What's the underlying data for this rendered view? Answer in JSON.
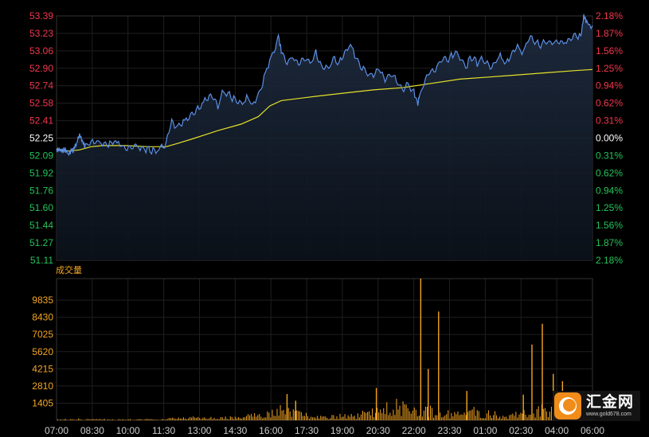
{
  "chart_data": [
    {
      "type": "line",
      "title": "",
      "price_ticks": [
        "53.39",
        "53.23",
        "53.06",
        "52.90",
        "52.74",
        "52.58",
        "52.41",
        "52.25",
        "52.09",
        "51.92",
        "51.76",
        "51.60",
        "51.44",
        "51.27",
        "51.11"
      ],
      "pct_ticks": [
        "2.18%",
        "1.87%",
        "1.56%",
        "1.25%",
        "0.94%",
        "0.62%",
        "0.31%",
        "0.00%",
        "0.31%",
        "0.62%",
        "0.94%",
        "1.25%",
        "1.56%",
        "1.87%",
        "2.18%"
      ],
      "ylim": [
        51.11,
        53.39
      ],
      "reference_price": 52.25,
      "x_ticks": [
        "07:00",
        "08:30",
        "10:00",
        "11:30",
        "13:00",
        "14:30",
        "16:00",
        "17:30",
        "19:00",
        "20:30",
        "22:00",
        "23:30",
        "01:00",
        "02:30",
        "04:00",
        "06:00"
      ],
      "series": [
        {
          "color": "#5b8fe6",
          "points": [
            [
              0,
              52.15
            ],
            [
              0.5,
              52.14
            ],
            [
              1,
              52.12
            ],
            [
              1.5,
              52.14
            ],
            [
              2,
              52.1
            ],
            [
              2.5,
              52.13
            ],
            [
              3,
              52.15
            ],
            [
              3.5,
              52.2
            ],
            [
              4,
              52.28
            ],
            [
              4.5,
              52.22
            ],
            [
              5,
              52.18
            ],
            [
              6,
              52.2
            ],
            [
              7,
              52.22
            ],
            [
              8,
              52.2
            ],
            [
              9,
              52.18
            ],
            [
              10,
              52.22
            ],
            [
              11,
              52.18
            ],
            [
              12,
              52.17
            ],
            [
              13,
              52.15
            ],
            [
              14,
              52.18
            ],
            [
              15,
              52.15
            ],
            [
              16,
              52.14
            ],
            [
              17,
              52.13
            ],
            [
              18,
              52.15
            ],
            [
              19,
              52.2
            ],
            [
              20,
              52.4
            ],
            [
              21,
              52.35
            ],
            [
              22,
              52.4
            ],
            [
              23,
              52.45
            ],
            [
              24,
              52.5
            ],
            [
              25,
              52.55
            ],
            [
              26,
              52.62
            ],
            [
              27,
              52.66
            ],
            [
              28,
              52.55
            ],
            [
              29,
              52.7
            ],
            [
              30,
              52.65
            ],
            [
              31,
              52.6
            ],
            [
              32,
              52.58
            ],
            [
              33,
              52.64
            ],
            [
              34,
              52.56
            ],
            [
              35,
              52.65
            ],
            [
              36,
              52.8
            ],
            [
              37,
              52.95
            ],
            [
              38,
              53.1
            ],
            [
              38.5,
              53.22
            ],
            [
              39,
              53.05
            ],
            [
              40,
              52.95
            ],
            [
              41,
              53.0
            ],
            [
              42,
              52.95
            ],
            [
              43,
              53.0
            ],
            [
              44,
              52.96
            ],
            [
              45,
              53.05
            ],
            [
              46,
              52.92
            ],
            [
              47,
              52.9
            ],
            [
              48,
              53.0
            ],
            [
              49,
              52.95
            ],
            [
              50,
              53.05
            ],
            [
              51,
              53.12
            ],
            [
              52,
              53.0
            ],
            [
              53,
              52.9
            ],
            [
              54,
              52.85
            ],
            [
              55,
              52.82
            ],
            [
              56,
              52.9
            ],
            [
              57,
              52.8
            ],
            [
              58,
              52.85
            ],
            [
              59,
              52.8
            ],
            [
              60,
              52.7
            ],
            [
              61,
              52.76
            ],
            [
              62,
              52.68
            ],
            [
              62.7,
              52.56
            ],
            [
              63,
              52.65
            ],
            [
              64,
              52.8
            ],
            [
              65,
              52.88
            ],
            [
              66,
              52.9
            ],
            [
              67,
              53.0
            ],
            [
              68,
              52.98
            ],
            [
              69,
              53.05
            ],
            [
              70,
              53.0
            ],
            [
              71,
              52.92
            ],
            [
              72,
              53.0
            ],
            [
              73,
              52.95
            ],
            [
              74,
              53.0
            ],
            [
              75,
              52.92
            ],
            [
              76,
              52.95
            ],
            [
              77,
              53.02
            ],
            [
              78,
              52.95
            ],
            [
              79,
              53.05
            ],
            [
              80,
              53.1
            ],
            [
              81,
              53.05
            ],
            [
              82,
              53.2
            ],
            [
              83,
              53.15
            ],
            [
              84,
              53.12
            ],
            [
              85,
              53.15
            ],
            [
              86,
              53.14
            ],
            [
              87,
              53.16
            ],
            [
              88,
              53.15
            ],
            [
              89,
              53.18
            ],
            [
              90,
              53.2
            ],
            [
              91,
              53.2
            ],
            [
              91.5,
              53.38
            ],
            [
              92,
              53.33
            ],
            [
              93,
              53.3
            ]
          ]
        },
        {
          "color": "#e6e02a",
          "points": [
            [
              0,
              52.15
            ],
            [
              2,
              52.13
            ],
            [
              4,
              52.14
            ],
            [
              6,
              52.17
            ],
            [
              8,
              52.18
            ],
            [
              12,
              52.18
            ],
            [
              16,
              52.17
            ],
            [
              19,
              52.17
            ],
            [
              21,
              52.2
            ],
            [
              24,
              52.25
            ],
            [
              28,
              52.32
            ],
            [
              32,
              52.38
            ],
            [
              35,
              52.45
            ],
            [
              37,
              52.55
            ],
            [
              39,
              52.6
            ],
            [
              45,
              52.64
            ],
            [
              50,
              52.67
            ],
            [
              55,
              52.7
            ],
            [
              60,
              52.72
            ],
            [
              65,
              52.76
            ],
            [
              70,
              52.8
            ],
            [
              75,
              52.82
            ],
            [
              80,
              52.84
            ],
            [
              85,
              52.86
            ],
            [
              90,
              52.88
            ],
            [
              93,
              52.89
            ]
          ]
        }
      ]
    },
    {
      "type": "bar",
      "title": "成交量",
      "yticks": [
        "9835",
        "8430",
        "7025",
        "5620",
        "4215",
        "2810",
        "1405"
      ],
      "ylim": [
        0,
        11600
      ],
      "x_ticks": [
        "07:00",
        "08:30",
        "10:00",
        "11:30",
        "13:00",
        "14:30",
        "16:00",
        "17:30",
        "19:00",
        "20:30",
        "22:00",
        "23:30",
        "01:00",
        "02:30",
        "04:00",
        "06:00"
      ],
      "bar_color": "#f5a623",
      "spikes": [
        [
          40.0,
          2150
        ],
        [
          41.5,
          1600
        ],
        [
          55.5,
          2650
        ],
        [
          63.2,
          11600
        ],
        [
          64.5,
          4200
        ],
        [
          66.3,
          8900
        ],
        [
          71.2,
          2400
        ],
        [
          81.0,
          2100
        ],
        [
          82.5,
          6200
        ],
        [
          84.3,
          7900
        ],
        [
          86.2,
          3800
        ],
        [
          87.8,
          3200
        ],
        [
          88.8,
          1200
        ],
        [
          90.0,
          1200
        ]
      ],
      "base": [
        [
          0,
          80
        ],
        [
          2,
          60
        ],
        [
          4,
          90
        ],
        [
          6,
          50
        ],
        [
          8,
          80
        ],
        [
          10,
          40
        ],
        [
          12,
          60
        ],
        [
          14,
          50
        ],
        [
          16,
          70
        ],
        [
          18,
          50
        ],
        [
          20,
          120
        ],
        [
          22,
          150
        ],
        [
          24,
          180
        ],
        [
          26,
          150
        ],
        [
          28,
          180
        ],
        [
          30,
          200
        ],
        [
          32,
          250
        ],
        [
          34,
          300
        ],
        [
          36,
          350
        ],
        [
          38,
          500
        ],
        [
          39,
          700
        ],
        [
          42,
          450
        ],
        [
          44,
          250
        ],
        [
          46,
          200
        ],
        [
          48,
          250
        ],
        [
          50,
          300
        ],
        [
          52,
          350
        ],
        [
          54,
          500
        ],
        [
          56,
          600
        ],
        [
          58,
          900
        ],
        [
          60,
          1100
        ],
        [
          62,
          800
        ],
        [
          64,
          700
        ],
        [
          66,
          600
        ],
        [
          68,
          500
        ],
        [
          70,
          450
        ],
        [
          72,
          600
        ],
        [
          74,
          500
        ],
        [
          76,
          400
        ],
        [
          78,
          300
        ],
        [
          80,
          400
        ],
        [
          82,
          500
        ],
        [
          84,
          700
        ],
        [
          86,
          600
        ],
        [
          88,
          500
        ],
        [
          90,
          300
        ],
        [
          92,
          200
        ],
        [
          93,
          150
        ]
      ]
    }
  ],
  "logo": {
    "name": "汇金网",
    "url": "www.gold678.com"
  }
}
